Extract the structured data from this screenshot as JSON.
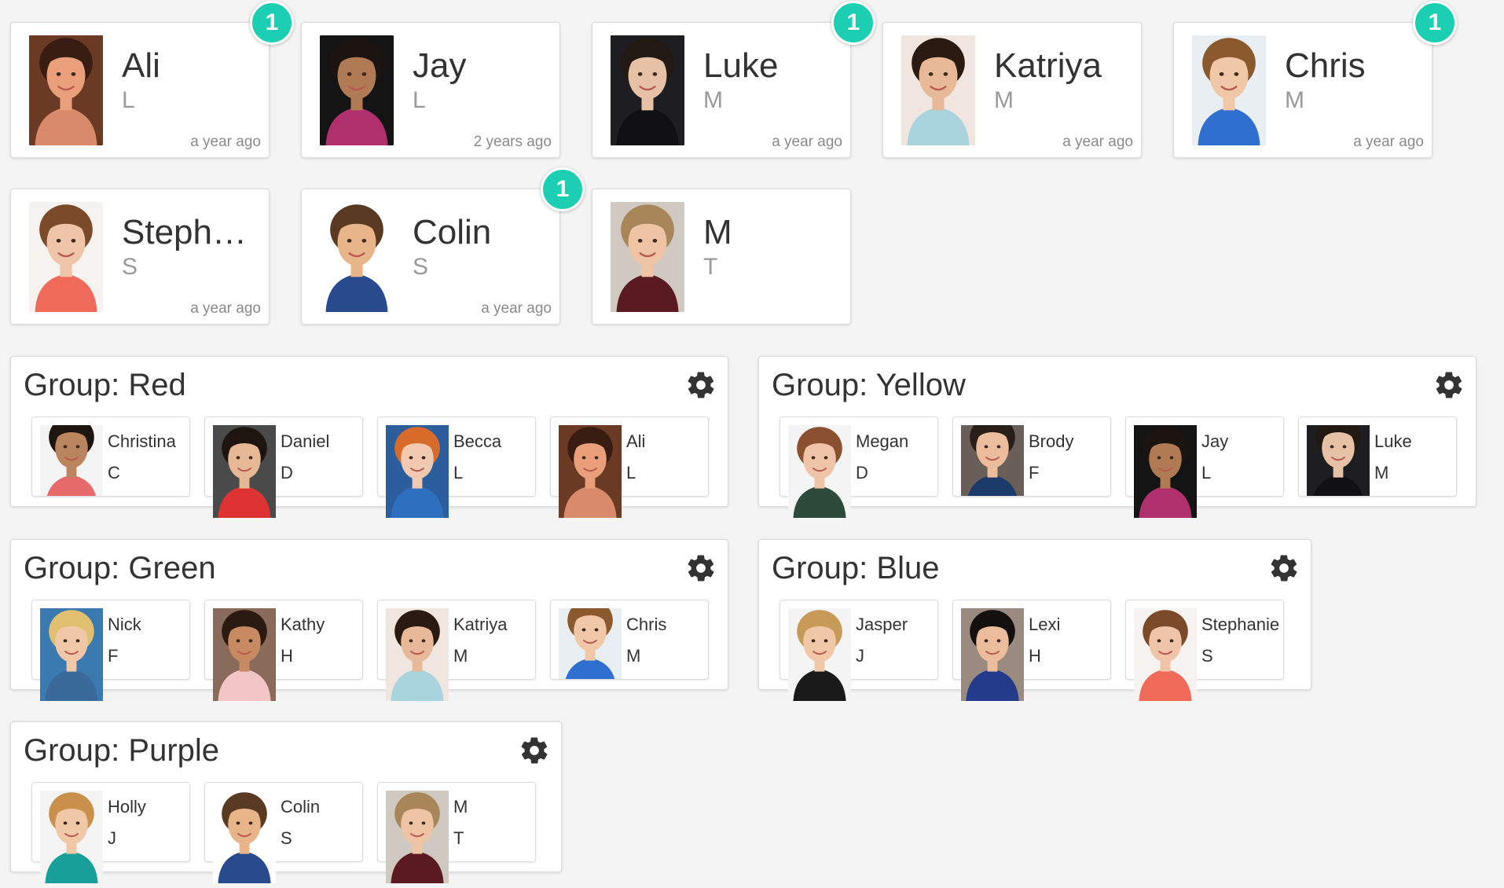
{
  "badge_color": "#1ccfb3",
  "cards": [
    {
      "name": "Ali",
      "initial": "L",
      "time": "a year ago",
      "badge": "1",
      "photo": {
        "bg": "#6b3a25",
        "skin": "#e9a07a",
        "hair": "#3a1d12",
        "shirt": "#d98a6a"
      }
    },
    {
      "name": "Jay",
      "initial": "L",
      "time": "2 years ago",
      "badge": "",
      "photo": {
        "bg": "#141414",
        "skin": "#b07a55",
        "hair": "#1b1410",
        "shirt": "#b0306e"
      }
    },
    {
      "name": "Luke",
      "initial": "M",
      "time": "a year ago",
      "badge": "1",
      "photo": {
        "bg": "#1e1e22",
        "skin": "#e7c1a6",
        "hair": "#221912",
        "shirt": "#111114"
      }
    },
    {
      "name": "Katriya",
      "initial": "M",
      "time": "a year ago",
      "badge": "",
      "photo": {
        "bg": "#f1e6df",
        "skin": "#e8b999",
        "hair": "#2a1a12",
        "shirt": "#a9d3dd"
      }
    },
    {
      "name": "Chris",
      "initial": "M",
      "time": "a year ago",
      "badge": "1",
      "photo": {
        "bg": "#e9eef2",
        "skin": "#f0c8a8",
        "hair": "#8a5a2e",
        "shirt": "#2f6fd0"
      }
    },
    {
      "name": "Stephanie",
      "initial": "S",
      "time": "a year ago",
      "badge": "",
      "photo": {
        "bg": "#f6f2f0",
        "skin": "#efc4a8",
        "hair": "#7a4a2a",
        "shirt": "#f06a5a"
      }
    },
    {
      "name": "Colin",
      "initial": "S",
      "time": "a year ago",
      "badge": "1",
      "photo": {
        "bg": "#ffffff",
        "skin": "#e8b48a",
        "hair": "#5a3a22",
        "shirt": "#2a4a8e"
      }
    },
    {
      "name": "M",
      "initial": "T",
      "time": "",
      "badge": "",
      "photo": {
        "bg": "#cfc9c2",
        "skin": "#eec4a5",
        "hair": "#a8865a",
        "shirt": "#5a1a22"
      }
    }
  ],
  "groups": [
    {
      "title": "Group: Red",
      "members": [
        {
          "name": "Christina",
          "initial": "C",
          "photo": {
            "bg": "#f4f4f4",
            "skin": "#b9845e",
            "hair": "#1e1410",
            "shirt": "#e76a6a"
          }
        },
        {
          "name": "Daniel",
          "initial": "D",
          "photo": {
            "bg": "#4a4a4a",
            "skin": "#e7b896",
            "hair": "#1e1510",
            "shirt": "#d33"
          }
        },
        {
          "name": "Becca",
          "initial": "L",
          "photo": {
            "bg": "#2c5e9e",
            "skin": "#f0c9b0",
            "hair": "#d86a2a",
            "shirt": "#2f6fc0"
          }
        },
        {
          "name": "Ali",
          "initial": "L",
          "photo": {
            "bg": "#6b3a25",
            "skin": "#e9a07a",
            "hair": "#3a1d12",
            "shirt": "#d98a6a"
          }
        }
      ]
    },
    {
      "title": "Group: Yellow",
      "members": [
        {
          "name": "Megan",
          "initial": "D",
          "photo": {
            "bg": "#f4f4f4",
            "skin": "#efc4a8",
            "hair": "#8a5030",
            "shirt": "#2e4a3a"
          }
        },
        {
          "name": "Brody",
          "initial": "F",
          "photo": {
            "bg": "#6a5e58",
            "skin": "#ebbd9c",
            "hair": "#2a1e18",
            "shirt": "#1c3a6a"
          }
        },
        {
          "name": "Jay",
          "initial": "L",
          "photo": {
            "bg": "#141414",
            "skin": "#b07a55",
            "hair": "#1b1410",
            "shirt": "#b0306e"
          }
        },
        {
          "name": "Luke",
          "initial": "M",
          "photo": {
            "bg": "#1e1e22",
            "skin": "#e7c1a6",
            "hair": "#221912",
            "shirt": "#111114"
          }
        }
      ]
    },
    {
      "title": "Group: Green",
      "members": [
        {
          "name": "Nick",
          "initial": "F",
          "photo": {
            "bg": "#3a7ab0",
            "skin": "#f0c8a8",
            "hair": "#e0c070",
            "shirt": "#3a6a9a"
          }
        },
        {
          "name": "Kathy",
          "initial": "H",
          "photo": {
            "bg": "#8a6a5a",
            "skin": "#c88a62",
            "hair": "#2a1a12",
            "shirt": "#f2c6c6"
          }
        },
        {
          "name": "Katriya",
          "initial": "M",
          "photo": {
            "bg": "#f1e6df",
            "skin": "#e8b999",
            "hair": "#2a1a12",
            "shirt": "#a9d3dd"
          }
        },
        {
          "name": "Chris",
          "initial": "M",
          "photo": {
            "bg": "#e9eef2",
            "skin": "#f0c8a8",
            "hair": "#8a5a2e",
            "shirt": "#2f6fd0"
          }
        }
      ]
    },
    {
      "title": "Group: Blue",
      "members": [
        {
          "name": "Jasper",
          "initial": "J",
          "photo": {
            "bg": "#f4f4f4",
            "skin": "#f0c8a8",
            "hair": "#c89a5a",
            "shirt": "#1a1a1a"
          }
        },
        {
          "name": "Lexi",
          "initial": "H",
          "photo": {
            "bg": "#9a8a80",
            "skin": "#ebbd9c",
            "hair": "#141010",
            "shirt": "#243a8a"
          }
        },
        {
          "name": "Stephanie",
          "initial": "S",
          "photo": {
            "bg": "#f6f2f0",
            "skin": "#efc4a8",
            "hair": "#7a4a2a",
            "shirt": "#f06a5a"
          }
        }
      ]
    },
    {
      "title": "Group: Purple",
      "members": [
        {
          "name": "Holly",
          "initial": "J",
          "photo": {
            "bg": "#f4f4f4",
            "skin": "#f0c8a8",
            "hair": "#c8904a",
            "shirt": "#1aa09a"
          }
        },
        {
          "name": "Colin",
          "initial": "S",
          "photo": {
            "bg": "#ffffff",
            "skin": "#e8b48a",
            "hair": "#5a3a22",
            "shirt": "#2a4a8e"
          }
        },
        {
          "name": "M",
          "initial": "T",
          "photo": {
            "bg": "#cfc9c2",
            "skin": "#eec4a5",
            "hair": "#a8865a",
            "shirt": "#5a1a22"
          }
        }
      ]
    }
  ]
}
